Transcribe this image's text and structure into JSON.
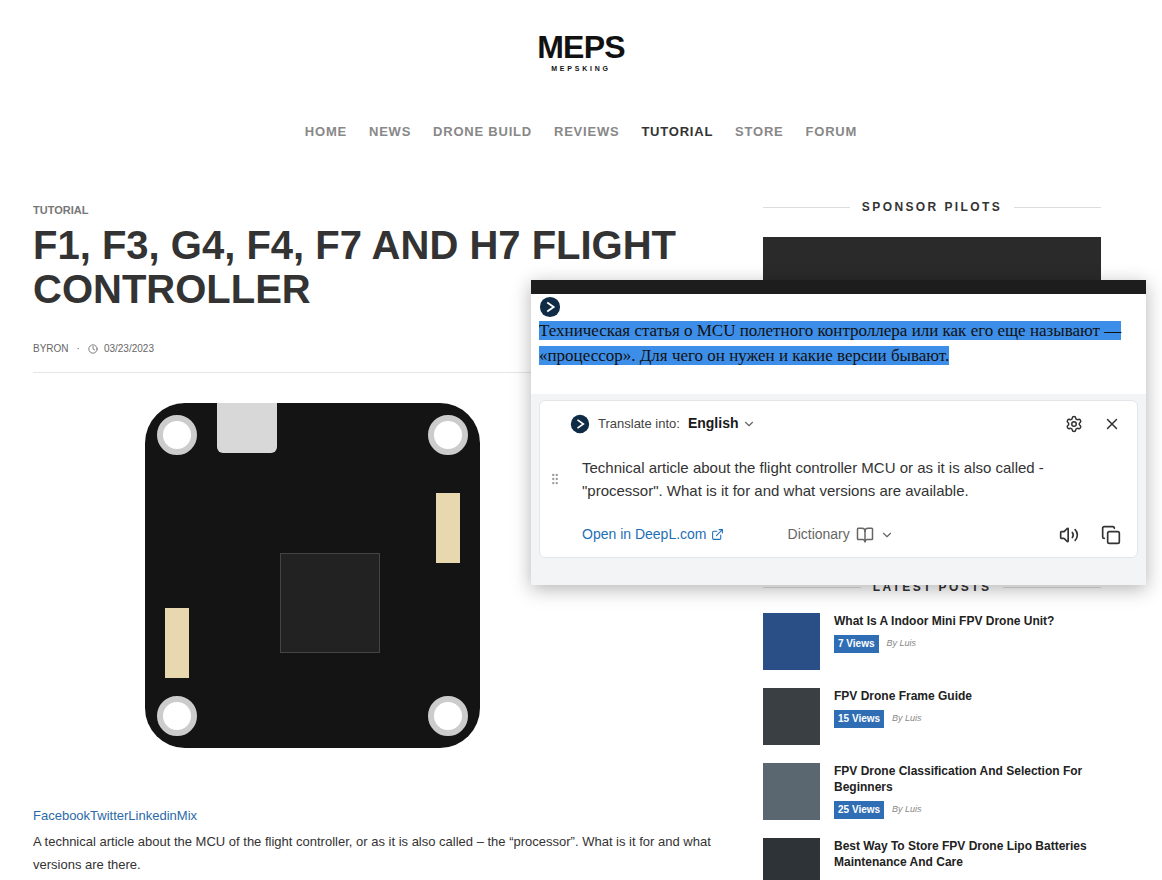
{
  "logo": {
    "title": "MEPS",
    "subtitle": "MEPSKING"
  },
  "nav": [
    {
      "label": "HOME",
      "selected": false
    },
    {
      "label": "NEWS",
      "selected": false
    },
    {
      "label": "DRONE BUILD",
      "selected": false
    },
    {
      "label": "REVIEWS",
      "selected": false
    },
    {
      "label": "TUTORIAL",
      "selected": true
    },
    {
      "label": "STORE",
      "selected": false
    },
    {
      "label": "FORUM",
      "selected": false
    }
  ],
  "article": {
    "category": "TUTORIAL",
    "title": "F1, F3, G4, F4, F7 AND H7 FLIGHT CONTROLLER",
    "author": "BYRON",
    "separator": "·",
    "date": "03/23/2023",
    "share_links": "FacebookTwitterLinkedinMix",
    "intro": "A technical article about the MCU of the flight controller, or as it is also called – the “processor”. What is it for and what versions are there."
  },
  "sidebar": {
    "sponsor_heading": "SPONSOR PILOTS",
    "latest_heading": "LATEST POSTS",
    "posts": [
      {
        "title": "What Is A Indoor Mini FPV Drone Unit?",
        "views": "7 Views",
        "author": "By Luis"
      },
      {
        "title": "FPV Drone Frame Guide",
        "views": "15 Views",
        "author": "By Luis"
      },
      {
        "title": "FPV Drone Classification And Selection For Beginners",
        "views": "25 Views",
        "author": "By Luis"
      },
      {
        "title": "Best Way To Store FPV Drone Lipo Batteries Maintenance And Care"
      }
    ]
  },
  "translator": {
    "selected_text": "Техническая статья о MCU полетного контроллера или как его еще называют — «процессор». Для чего он нужен и какие версии бывают.",
    "translate_into_label": "Translate into:",
    "language": "English",
    "translation": "Technical article about the flight controller MCU or as it is also called - \"processor\". What is it for and what versions are available.",
    "open_link": "Open in DeepL.com",
    "dictionary": "Dictionary"
  }
}
